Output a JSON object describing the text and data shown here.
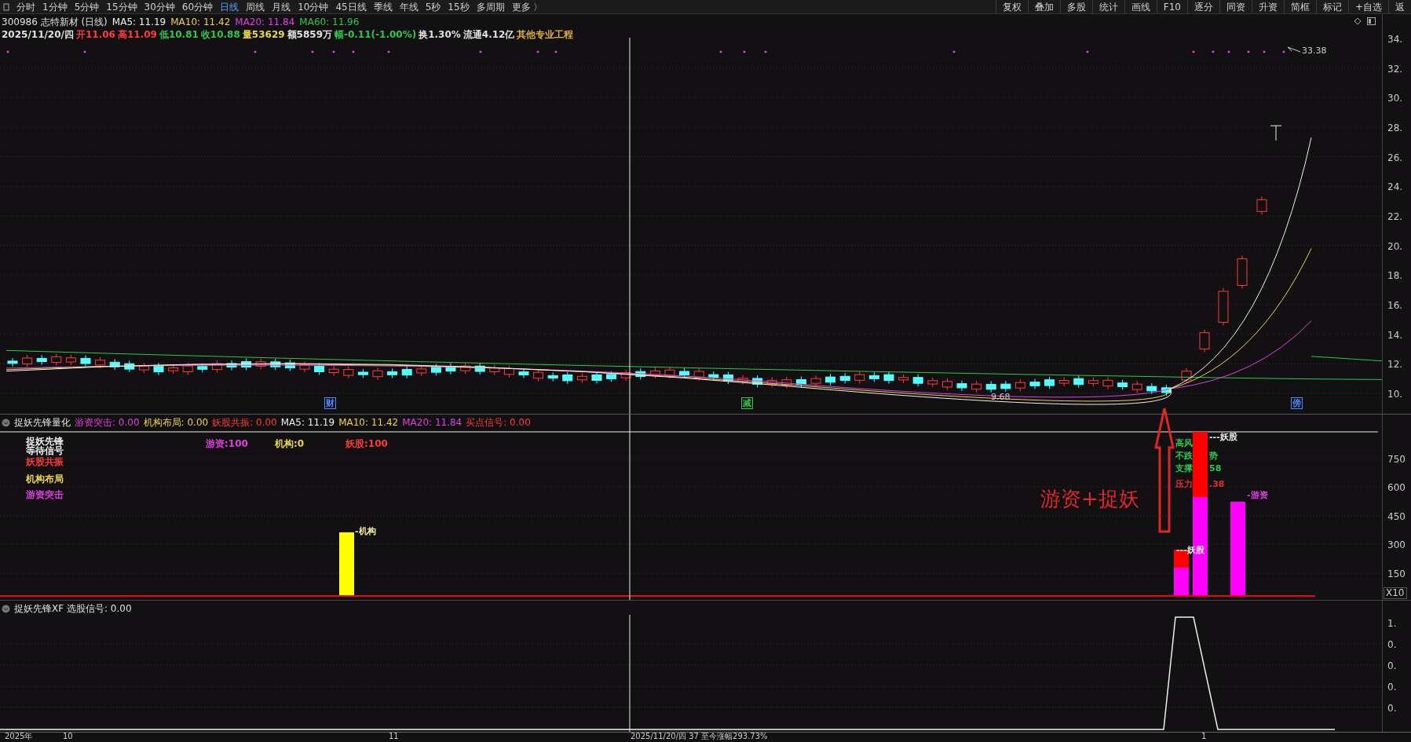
{
  "toolbar": {
    "periods": [
      {
        "label": "分时",
        "selected": false
      },
      {
        "label": "1分钟",
        "selected": false
      },
      {
        "label": "5分钟",
        "selected": false
      },
      {
        "label": "15分钟",
        "selected": false
      },
      {
        "label": "30分钟",
        "selected": false
      },
      {
        "label": "60分钟",
        "selected": false
      },
      {
        "label": "日线",
        "selected": true
      },
      {
        "label": "周线",
        "selected": false
      },
      {
        "label": "月线",
        "selected": false
      },
      {
        "label": "10分钟",
        "selected": false
      },
      {
        "label": "45日线",
        "selected": false
      },
      {
        "label": "季线",
        "selected": false
      },
      {
        "label": "年线",
        "selected": false
      },
      {
        "label": "5秒",
        "selected": false
      },
      {
        "label": "15秒",
        "selected": false
      },
      {
        "label": "多周期",
        "selected": false
      },
      {
        "label": "更多 〉",
        "selected": false
      }
    ],
    "tools": [
      "复权",
      "叠加",
      "多股",
      "统计",
      "画线",
      "F10",
      "逐分",
      "同资",
      "升资",
      "简框",
      "标记",
      "+自选",
      "返"
    ]
  },
  "main_chart": {
    "title_line": [
      {
        "text": "300986 志特新材 (日线)",
        "color": "#e0e0e0"
      },
      {
        "text": "MA5: 11.19",
        "color": "#f0f0f0"
      },
      {
        "text": "MA10: 11.42",
        "color": "#e8d44d"
      },
      {
        "text": "MA20: 11.84",
        "color": "#e040e0"
      },
      {
        "text": "MA60: 11.96",
        "color": "#2fc84a"
      }
    ],
    "quote_line": [
      {
        "text": "2025/11/20/四",
        "color": "#e0e0e0"
      },
      {
        "text": "开11.06",
        "color": "#ff3b3b"
      },
      {
        "text": "高11.09",
        "color": "#ff3b3b"
      },
      {
        "text": "低10.81",
        "color": "#2fc84a"
      },
      {
        "text": "收10.88",
        "color": "#2fc84a"
      },
      {
        "text": "量53629",
        "color": "#e8d44d"
      },
      {
        "text": "额5859万",
        "color": "#e0e0e0"
      },
      {
        "text": "幅-0.11(-1.00%)",
        "color": "#2fc84a"
      },
      {
        "text": "换1.30%",
        "color": "#e0e0e0"
      },
      {
        "text": "流通4.12亿",
        "color": "#e0e0e0"
      },
      {
        "text": "其他专业工程",
        "color": "#e0b040"
      }
    ],
    "high_label": "33.38",
    "low_label": "9.68",
    "markers": [
      {
        "text": "财",
        "color": "#4a8cff"
      },
      {
        "text": "减",
        "color": "#2fc84a"
      },
      {
        "text": "傍",
        "color": "#4a8cff"
      }
    ],
    "price_axis": [
      "34.",
      "32.",
      "30.",
      "28.",
      "26.",
      "24.",
      "22.",
      "20.",
      "18.",
      "16.",
      "14.",
      "12.",
      "10."
    ]
  },
  "indicator_1": {
    "header": [
      {
        "text": "捉妖先锋量化",
        "color": "#e0e0e0"
      },
      {
        "text": "游资突击: 0.00",
        "color": "#e040e0"
      },
      {
        "text": "机构布局: 0.00",
        "color": "#e8d44d"
      },
      {
        "text": "妖股共振: 0.00",
        "color": "#ff3b3b"
      },
      {
        "text": "MA5: 11.19",
        "color": "#f0f0f0"
      },
      {
        "text": "MA10: 11.42",
        "color": "#e8d44d"
      },
      {
        "text": "MA20: 11.84",
        "color": "#e040e0"
      },
      {
        "text": "买点信号: 0.00",
        "color": "#ff3b3b"
      }
    ],
    "legend": [
      {
        "text": "捉妖先锋",
        "color": "#f0f0f0"
      },
      {
        "text": "等待信号",
        "color": "#f0f0f0"
      },
      {
        "text": "妖股共振",
        "color": "#ff3b3b"
      },
      {
        "text": "机构布局",
        "color": "#e8d44d"
      },
      {
        "text": "游资突击",
        "color": "#e040e0"
      }
    ],
    "scores": [
      {
        "text": "游资:100",
        "color": "#e040e0"
      },
      {
        "text": "机构:0",
        "color": "#e8d44d"
      },
      {
        "text": "妖股:100",
        "color": "#ff3b3b"
      }
    ],
    "bar_labels": [
      {
        "text": "-机构",
        "color": "#f0f0a0"
      },
      {
        "text": "---妖股",
        "color": "#f0f0f0"
      },
      {
        "text": "---妖股",
        "color": "#f0f0f0"
      },
      {
        "text": "-游资",
        "color": "#e040e0"
      },
      {
        "text": "高风",
        "color": "#2fc84a"
      },
      {
        "text": "不跌",
        "color": "#2fc84a"
      },
      {
        "text": "势",
        "color": "#2fc84a"
      },
      {
        "text": "支撑",
        "color": "#2fc84a"
      },
      {
        "text": "58",
        "color": "#2fc84a"
      },
      {
        "text": "压力",
        "color": "#e03030"
      },
      {
        "text": ".38",
        "color": "#e03030"
      }
    ],
    "annotation": "游资+捉妖",
    "axis": [
      "750",
      "600",
      "450",
      "300",
      "150"
    ],
    "scale": "X10"
  },
  "indicator_2": {
    "header": "捉妖先锋XF 选股信号: 0.00",
    "axis": [
      "1.",
      "0.",
      "0.",
      "0.",
      "0."
    ]
  },
  "date_axis": [
    "2025年",
    "10",
    "11",
    "2025/11/20/四 37 至今涨幅293.73%",
    "1"
  ]
}
